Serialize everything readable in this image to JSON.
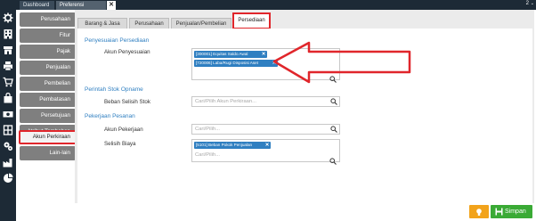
{
  "topbar": {
    "tabs": [
      "Dashboard",
      "Preferensi"
    ],
    "close_label": "✕",
    "count": "2",
    "caret": "⌄"
  },
  "sidebar_icons": [
    "gear-icon",
    "building-icon",
    "shop-icon",
    "printer-icon",
    "cart-icon",
    "bag-icon",
    "money-icon",
    "cash-register-icon",
    "gears-icon",
    "factory-icon",
    "pie-chart-icon"
  ],
  "leftnav": {
    "items": [
      "Perusahaan",
      "Fitur",
      "Pajak",
      "Penjualan",
      "Pembelian",
      "Pembatasan",
      "Persetujuan",
      "Atribut Tambahan",
      "Akun Perkiraan",
      "Lain-lain"
    ],
    "active_index": 8
  },
  "panel_tabs": {
    "items": [
      "Barang & Jasa",
      "Perusahaan",
      "Penjualan/Pembelian",
      "Persediaan"
    ],
    "active_index": 3
  },
  "sections": {
    "penyesuaian": {
      "title": "Penyesuaian Persediaan",
      "field_label": "Akun Penyesuaian",
      "chips": [
        "[300001] Equitas Saldo Awal",
        "[720006] Laba/Rugi Disposisi Aset"
      ],
      "chip_remove": "✕"
    },
    "opname": {
      "title": "Perintah Stok Opname",
      "field_label": "Beban Selisih Stok",
      "placeholder": "Cari/Pilih Akun Perkiraan..."
    },
    "pekerjaan": {
      "title": "Pekerjaan Pesanan",
      "akun_label": "Akun Pekerjaan",
      "akun_placeholder": "Cari/Pilih...",
      "selisih_label": "Selisih Biaya",
      "selisih_chips": [
        "[5101] Beban Pokok Penjualan"
      ],
      "selisih_placeholder": "Cari/Pilih..."
    }
  },
  "actions": {
    "save_label": "Simpan"
  },
  "colors": {
    "accent_blue": "#2f7fc1",
    "highlight_red": "#e0262b",
    "save_green": "#3aaa35",
    "warn_orange": "#f2a31b",
    "dark_navy": "#1d2a36"
  }
}
